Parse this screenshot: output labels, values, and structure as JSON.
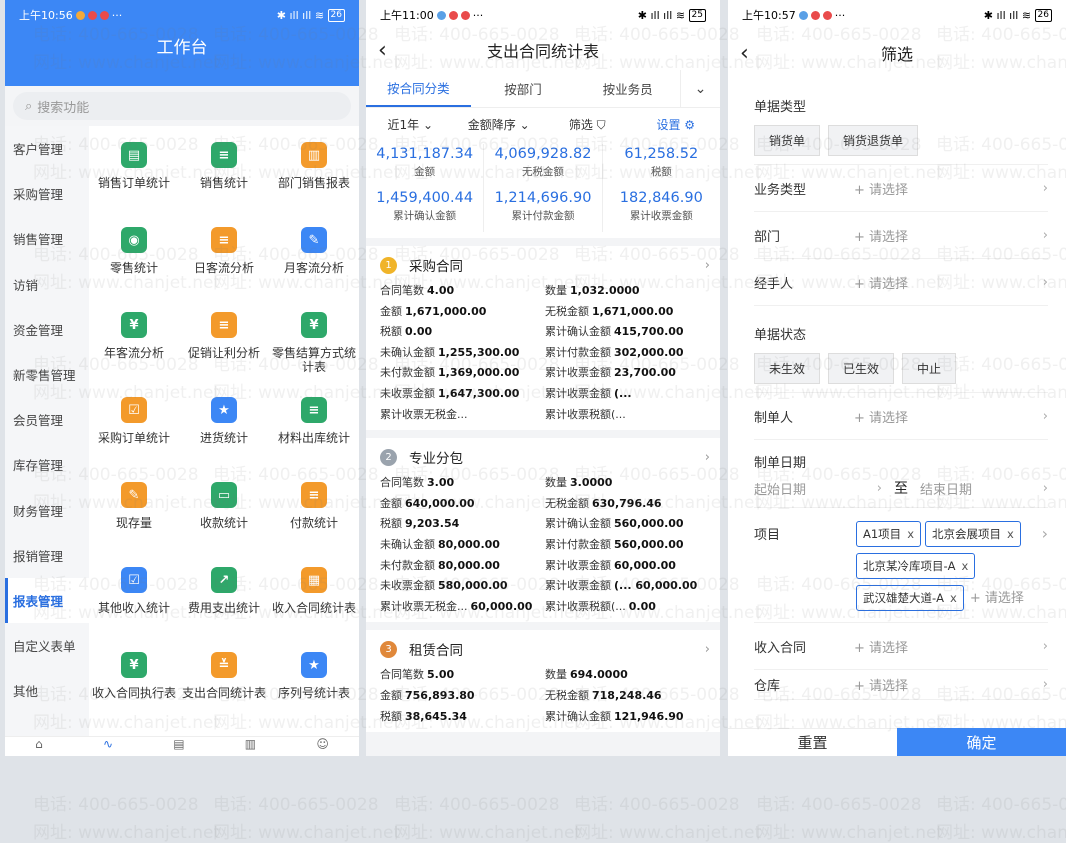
{
  "watermark": {
    "phone": "电话: 400-665-0028",
    "site": "网址: www.chanjet.net"
  },
  "p1": {
    "time": "上午10:56",
    "battery": "26",
    "title": "工作台",
    "search": "搜索功能",
    "sidebar": [
      "客户管理",
      "采购管理",
      "销售管理",
      "访销",
      "资金管理",
      "新零售管理",
      "会员管理",
      "库存管理",
      "财务管理",
      "报销管理",
      "报表管理",
      "自定义表单",
      "其他"
    ],
    "active_index": 10,
    "grid": [
      {
        "label": "销售订单统计",
        "color": "#2ea86a",
        "icon": "▤"
      },
      {
        "label": "销售统计",
        "color": "#2ea86a",
        "icon": "≡"
      },
      {
        "label": "部门销售报表",
        "color": "#f39a2b",
        "icon": "▥"
      },
      {
        "label": "零售统计",
        "color": "#2ea86a",
        "icon": "◉"
      },
      {
        "label": "日客流分析",
        "color": "#f39a2b",
        "icon": "≡"
      },
      {
        "label": "月客流分析",
        "color": "#3c87f5",
        "icon": "✎"
      },
      {
        "label": "年客流分析",
        "color": "#2ea86a",
        "icon": "¥"
      },
      {
        "label": "促销让利分析",
        "color": "#f39a2b",
        "icon": "≡"
      },
      {
        "label": "零售结算方式统计表",
        "color": "#2ea86a",
        "icon": "¥"
      },
      {
        "label": "采购订单统计",
        "color": "#f39a2b",
        "icon": "☑"
      },
      {
        "label": "进货统计",
        "color": "#3c87f5",
        "icon": "★"
      },
      {
        "label": "材料出库统计",
        "color": "#2ea86a",
        "icon": "≡"
      },
      {
        "label": "现存量",
        "color": "#f39a2b",
        "icon": "✎"
      },
      {
        "label": "收款统计",
        "color": "#2ea86a",
        "icon": "▭"
      },
      {
        "label": "付款统计",
        "color": "#f39a2b",
        "icon": "≡"
      },
      {
        "label": "其他收入统计",
        "color": "#3c87f5",
        "icon": "☑"
      },
      {
        "label": "费用支出统计",
        "color": "#2ea86a",
        "icon": "↗"
      },
      {
        "label": "收入合同统计表",
        "color": "#f39a2b",
        "icon": "▦"
      },
      {
        "label": "收入合同执行表",
        "color": "#2ea86a",
        "icon": "¥"
      },
      {
        "label": "支出合同统计表",
        "color": "#f39a2b",
        "icon": "≚"
      },
      {
        "label": "序列号统计表",
        "color": "#3c87f5",
        "icon": "★"
      }
    ]
  },
  "p2": {
    "time": "上午11:00",
    "battery": "25",
    "title": "支出合同统计表",
    "tabs": [
      "按合同分类",
      "按部门",
      "按业务员"
    ],
    "filters": {
      "period": "近1年",
      "sort": "金额降序",
      "filter": "筛选",
      "settings": "设置"
    },
    "stats_row1": [
      {
        "v": "4,131,187.34",
        "l": "金额"
      },
      {
        "v": "4,069,928.82",
        "l": "无税金额"
      },
      {
        "v": "61,258.52",
        "l": "税额"
      }
    ],
    "stats_row2": [
      {
        "v": "1,459,400.44",
        "l": "累计确认金额"
      },
      {
        "v": "1,214,696.90",
        "l": "累计付款金额"
      },
      {
        "v": "182,846.90",
        "l": "累计收票金额"
      }
    ],
    "cards": [
      {
        "rank": "1",
        "color": "#f0b429",
        "name": "采购合同",
        "rows": [
          [
            "合同笔数",
            "4.00",
            "数量",
            "1,032.0000"
          ],
          [
            "金额",
            "1,671,000.00",
            "无税金额",
            "1,671,000.00"
          ],
          [
            "税额",
            "0.00",
            "累计确认金额",
            "415,700.00"
          ],
          [
            "未确认金额",
            "1,255,300.00",
            "累计付款金额",
            "302,000.00"
          ],
          [
            "未付款金额",
            "1,369,000.00",
            "累计收票金额",
            "23,700.00"
          ],
          [
            "未收票金额",
            "1,647,300.00",
            "累计收票金额",
            "(..."
          ],
          [
            "累计收票无税金...",
            "",
            "累计收票税额(...",
            ""
          ]
        ]
      },
      {
        "rank": "2",
        "color": "#9aa3ad",
        "name": "专业分包",
        "rows": [
          [
            "合同笔数",
            "3.00",
            "数量",
            "3.0000"
          ],
          [
            "金额",
            "640,000.00",
            "无税金额",
            "630,796.46"
          ],
          [
            "税额",
            "9,203.54",
            "累计确认金额",
            "560,000.00"
          ],
          [
            "未确认金额",
            "80,000.00",
            "累计付款金额",
            "560,000.00"
          ],
          [
            "未付款金额",
            "80,000.00",
            "累计收票金额",
            "60,000.00"
          ],
          [
            "未收票金额",
            "580,000.00",
            "累计收票金额",
            "(... 60,000.00"
          ],
          [
            "累计收票无税金...",
            "60,000.00",
            "累计收票税额(...",
            "0.00"
          ]
        ]
      },
      {
        "rank": "3",
        "color": "#e0883a",
        "name": "租赁合同",
        "rows": [
          [
            "合同笔数",
            "5.00",
            "数量",
            "694.0000"
          ],
          [
            "金额",
            "756,893.80",
            "无税金额",
            "718,248.46"
          ],
          [
            "税额",
            "38,645.34",
            "累计确认金额",
            "121,946.90"
          ]
        ]
      }
    ]
  },
  "p3": {
    "time": "上午10:57",
    "battery": "26",
    "title": "筛选",
    "doc_type_label": "单据类型",
    "doc_types": [
      "销货单",
      "销货退货单"
    ],
    "biz_type": "业务类型",
    "dept": "部门",
    "handler": "经手人",
    "status_label": "单据状态",
    "statuses": [
      "未生效",
      "已生效",
      "中止"
    ],
    "maker": "制单人",
    "date_label": "制单日期",
    "start_date": "起始日期",
    "to": "至",
    "end_date": "结束日期",
    "project": "项目",
    "tags": [
      "A1项目",
      "北京会展项目",
      "北京某冷库项目-A",
      "武汉雄楚大道-A"
    ],
    "income_contract": "收入合同",
    "warehouse": "仓库",
    "placeholder": "+ 请选择",
    "reset": "重置",
    "confirm": "确定"
  }
}
